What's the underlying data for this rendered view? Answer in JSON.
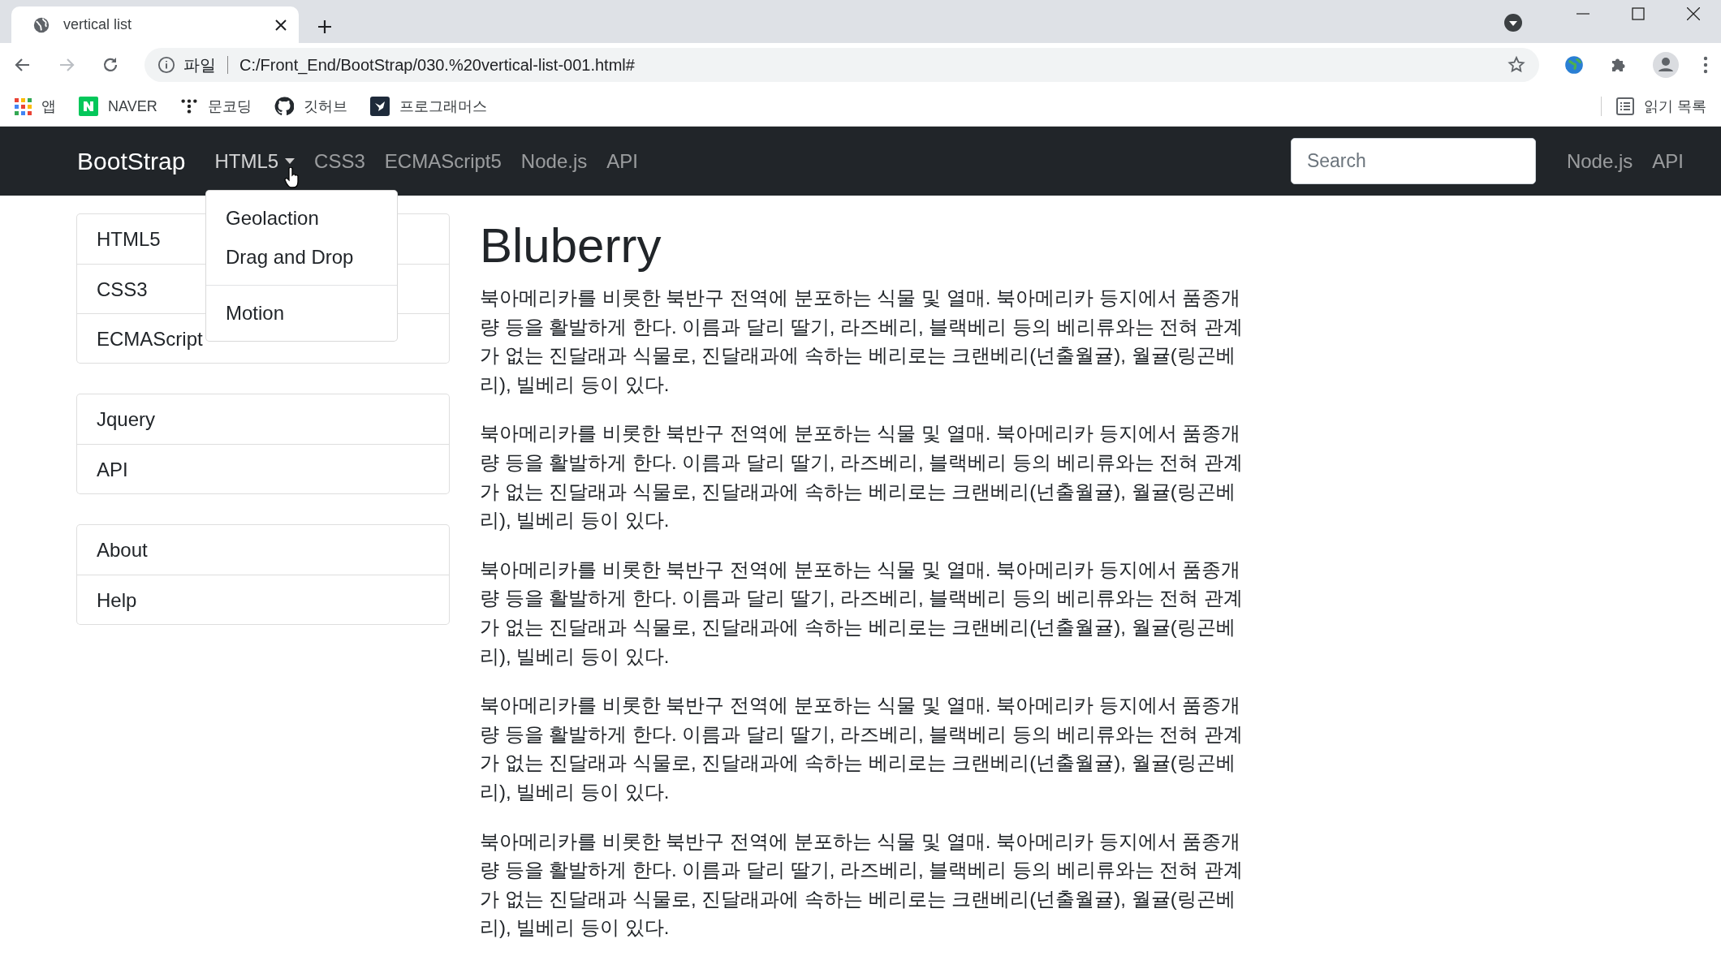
{
  "browser": {
    "tabs": [
      {
        "title": "vertical list",
        "selected": true
      }
    ],
    "forward_disabled": true,
    "address": {
      "scheme": "파일",
      "url": "C:/Front_End/BootStrap/030.%20vertical-list-001.html#"
    },
    "bookmarks": [
      {
        "label": "앱",
        "kind": "apps"
      },
      {
        "label": "NAVER",
        "kind": "naver"
      },
      {
        "label": "문코딩",
        "kind": "dots"
      },
      {
        "label": "깃허브",
        "kind": "github"
      },
      {
        "label": "프로그래머스",
        "kind": "programmers"
      }
    ],
    "reading_list": "읽기 목록"
  },
  "navbar": {
    "brand": "BootStrap",
    "links": [
      {
        "label": "HTML5",
        "kind": "dropdown",
        "expanded": true
      },
      {
        "label": "CSS3",
        "kind": "link"
      },
      {
        "label": "ECMAScript5",
        "kind": "link"
      },
      {
        "label": "Node.js",
        "kind": "link"
      },
      {
        "label": "API",
        "kind": "link"
      }
    ],
    "search": {
      "placeholder": "Search"
    },
    "right_links": [
      {
        "label": "Node.js"
      },
      {
        "label": "API"
      }
    ],
    "dropdown": [
      {
        "kind": "item",
        "label": "Geolaction"
      },
      {
        "kind": "item",
        "label": "Drag and Drop"
      },
      {
        "kind": "divider"
      },
      {
        "kind": "item",
        "label": "Motion"
      }
    ]
  },
  "sidebar": {
    "groups": [
      {
        "items": [
          {
            "label": "HTML5"
          },
          {
            "label": "CSS3"
          },
          {
            "label": "ECMAScript"
          }
        ]
      },
      {
        "items": [
          {
            "label": "Jquery"
          },
          {
            "label": "API"
          }
        ]
      },
      {
        "items": [
          {
            "label": "About"
          },
          {
            "label": "Help"
          }
        ]
      }
    ]
  },
  "content": {
    "heading": "Bluberry",
    "paragraphs": [
      "북아메리카를 비롯한 북반구 전역에 분포하는 식물 및 열매. 북아메리카 등지에서 품종개량 등을 활발하게 한다. 이름과 달리 딸기, 라즈베리, 블랙베리 등의 베리류와는 전혀 관계가 없는 진달래과 식물로, 진달래과에 속하는 베리로는 크랜베리(넌출월귤), 월귤(링곤베리), 빌베리 등이 있다.",
      "북아메리카를 비롯한 북반구 전역에 분포하는 식물 및 열매. 북아메리카 등지에서 품종개량 등을 활발하게 한다. 이름과 달리 딸기, 라즈베리, 블랙베리 등의 베리류와는 전혀 관계가 없는 진달래과 식물로, 진달래과에 속하는 베리로는 크랜베리(넌출월귤), 월귤(링곤베리), 빌베리 등이 있다.",
      "북아메리카를 비롯한 북반구 전역에 분포하는 식물 및 열매. 북아메리카 등지에서 품종개량 등을 활발하게 한다. 이름과 달리 딸기, 라즈베리, 블랙베리 등의 베리류와는 전혀 관계가 없는 진달래과 식물로, 진달래과에 속하는 베리로는 크랜베리(넌출월귤), 월귤(링곤베리), 빌베리 등이 있다.",
      "북아메리카를 비롯한 북반구 전역에 분포하는 식물 및 열매. 북아메리카 등지에서 품종개량 등을 활발하게 한다. 이름과 달리 딸기, 라즈베리, 블랙베리 등의 베리류와는 전혀 관계가 없는 진달래과 식물로, 진달래과에 속하는 베리로는 크랜베리(넌출월귤), 월귤(링곤베리), 빌베리 등이 있다.",
      "북아메리카를 비롯한 북반구 전역에 분포하는 식물 및 열매. 북아메리카 등지에서 품종개량 등을 활발하게 한다. 이름과 달리 딸기, 라즈베리, 블랙베리 등의 베리류와는 전혀 관계가 없는 진달래과 식물로, 진달래과에 속하는 베리로는 크랜베리(넌출월귤), 월귤(링곤베리), 빌베리 등이 있다."
    ]
  }
}
